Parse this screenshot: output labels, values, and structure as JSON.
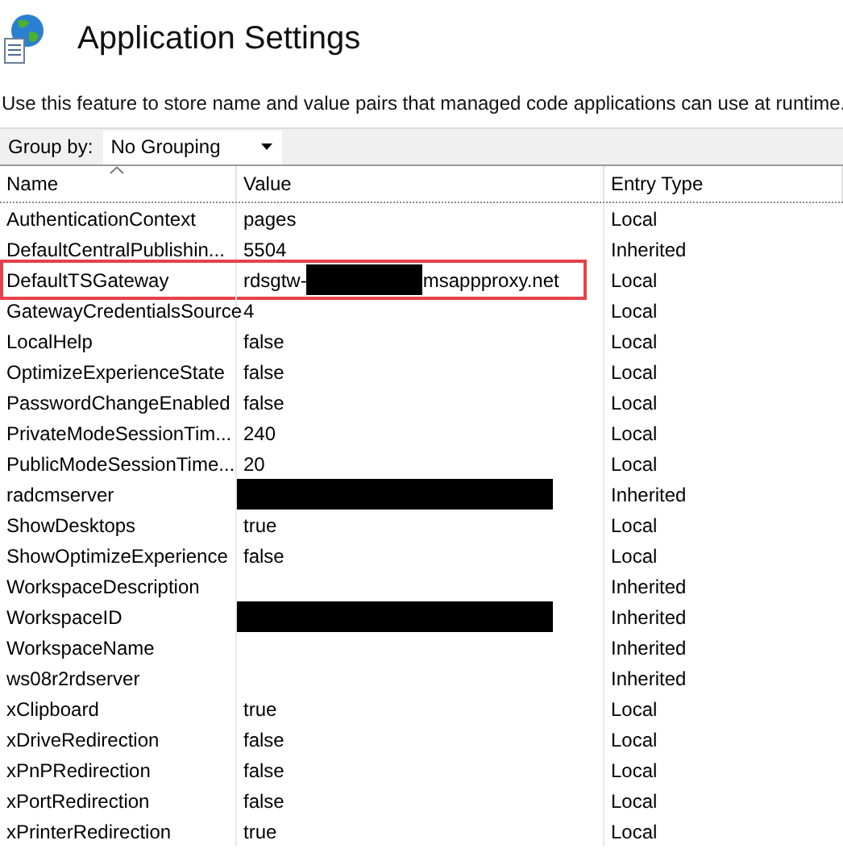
{
  "title": "Application Settings",
  "description": "Use this feature to store name and value pairs that managed code applications can use at runtime.",
  "group_by": {
    "label": "Group by:",
    "value": "No Grouping"
  },
  "table": {
    "columns": [
      {
        "label": "Name",
        "sorted": true
      },
      {
        "label": "Value",
        "sorted": false
      },
      {
        "label": "Entry Type",
        "sorted": false
      }
    ],
    "rows": [
      {
        "name": "AuthenticationContext",
        "value": "pages",
        "entry_type": "Local",
        "redacted": false,
        "highlighted": false
      },
      {
        "name": "DefaultCentralPublishin...",
        "value": "5504",
        "entry_type": "Inherited",
        "redacted": false,
        "highlighted": false
      },
      {
        "name": "DefaultTSGateway",
        "value": "rdsgtw-",
        "value_end": "msappproxy.net",
        "entry_type": "Local",
        "redacted": true,
        "highlighted": true
      },
      {
        "name": "GatewayCredentialsSource",
        "value": "4",
        "entry_type": "Local",
        "redacted": false,
        "highlighted": false
      },
      {
        "name": "LocalHelp",
        "value": "false",
        "entry_type": "Local",
        "redacted": false,
        "highlighted": false
      },
      {
        "name": "OptimizeExperienceState",
        "value": "false",
        "entry_type": "Local",
        "redacted": false,
        "highlighted": false
      },
      {
        "name": "PasswordChangeEnabled",
        "value": "false",
        "entry_type": "Local",
        "redacted": false,
        "highlighted": false
      },
      {
        "name": "PrivateModeSessionTim...",
        "value": "240",
        "entry_type": "Local",
        "redacted": false,
        "highlighted": false
      },
      {
        "name": "PublicModeSessionTime...",
        "value": "20",
        "entry_type": "Local",
        "redacted": false,
        "highlighted": false
      },
      {
        "name": "radcmserver",
        "entry_type": "Inherited",
        "redacted": true,
        "highlighted": false
      },
      {
        "name": "ShowDesktops",
        "value": "true",
        "entry_type": "Local",
        "redacted": false,
        "highlighted": false
      },
      {
        "name": "ShowOptimizeExperience",
        "value": "false",
        "entry_type": "Local",
        "redacted": false,
        "highlighted": false
      },
      {
        "name": "WorkspaceDescription",
        "entry_type": "Inherited",
        "redacted": false,
        "highlighted": false
      },
      {
        "name": "WorkspaceID",
        "entry_type": "Inherited",
        "redacted": true,
        "highlighted": false
      },
      {
        "name": "WorkspaceName",
        "entry_type": "Inherited",
        "redacted": false,
        "highlighted": false
      },
      {
        "name": "ws08r2rdserver",
        "entry_type": "Inherited",
        "redacted": false,
        "highlighted": false
      },
      {
        "name": "xClipboard",
        "value": "true",
        "entry_type": "Local",
        "redacted": false,
        "highlighted": false
      },
      {
        "name": "xDriveRedirection",
        "value": "false",
        "entry_type": "Local",
        "redacted": false,
        "highlighted": false
      },
      {
        "name": "xPnPRedirection",
        "value": "false",
        "entry_type": "Local",
        "redacted": false,
        "highlighted": false
      },
      {
        "name": "xPortRedirection",
        "value": "false",
        "entry_type": "Local",
        "redacted": false,
        "highlighted": false
      },
      {
        "name": "xPrinterRedirection",
        "value": "true",
        "entry_type": "Local",
        "redacted": false,
        "highlighted": false
      }
    ]
  }
}
